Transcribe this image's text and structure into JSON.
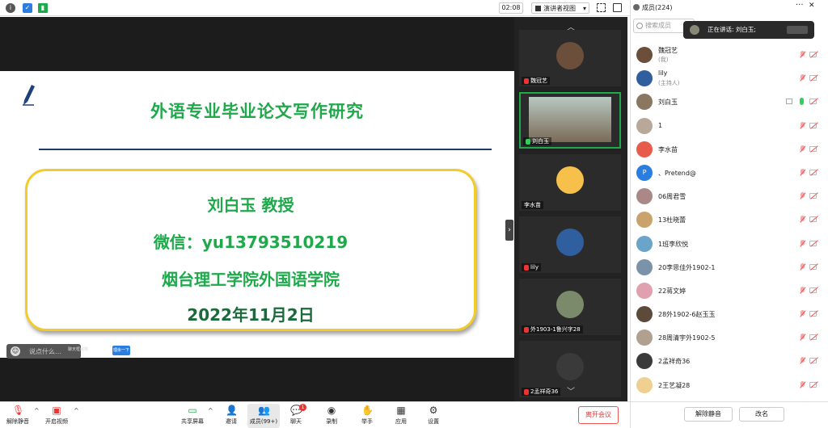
{
  "topbar": {
    "time": "02:08",
    "view_mode": "演讲者视图"
  },
  "slide": {
    "title": "外语专业毕业论文写作研究",
    "name_line": "刘白玉  教授",
    "wechat_line": "微信：yu13793510219",
    "org_line": "烟台理工学院外国语学院",
    "date_line": "2022年11月2日"
  },
  "chat": {
    "placeholder": "说点什么…",
    "tip": "聊天框缩略",
    "button": "理余一下"
  },
  "strip": {
    "tiles": [
      {
        "name": "魏冠艺",
        "color": "#6b4f3a",
        "mic": "muted"
      },
      {
        "name": "刘白玉",
        "color": "#8a7761",
        "mic": "on",
        "active": true
      },
      {
        "name": "李水苗",
        "color": "#f6c04a",
        "mic": "none"
      },
      {
        "name": "lily",
        "color": "#2f5f9e",
        "mic": "muted"
      },
      {
        "name": "外1903-1鲁兴字28",
        "color": "#7a8a6a",
        "mic": "muted"
      },
      {
        "name": "2孟祥奇36",
        "color": "#3a3a3a",
        "mic": "muted"
      }
    ]
  },
  "toolbar": {
    "unmute": "解除静音",
    "video": "开启视频",
    "share": "共享屏幕",
    "invite": "邀请",
    "members": "成员(99+)",
    "chat": "聊天",
    "chat_badge": "1",
    "record": "录制",
    "raise": "举手",
    "apps": "应用",
    "settings": "设置",
    "leave": "离开会议"
  },
  "panel": {
    "title": "成员(224)",
    "search_placeholder": "搜索成员",
    "speaking": "正在讲话: 刘白玉;",
    "members": [
      {
        "name": "魏冠艺",
        "role": "(我)",
        "color": "#6b4f3a"
      },
      {
        "name": "lily",
        "role": "(主持人)",
        "color": "#2f5f9e"
      },
      {
        "name": "刘白玉",
        "role": "",
        "color": "#8a7761",
        "speaking": true
      },
      {
        "name": "1",
        "role": "",
        "color": "#b7a89a"
      },
      {
        "name": "李水苗",
        "role": "",
        "color": "#e85a4a"
      },
      {
        "name": "、Pretend@",
        "role": "",
        "color": "#2a7de1",
        "initial": "P"
      },
      {
        "name": "06周君雪",
        "role": "",
        "color": "#a88"
      },
      {
        "name": "13杜晓蕾",
        "role": "",
        "color": "#c9a36b"
      },
      {
        "name": "1班李欣悦",
        "role": "",
        "color": "#6aa4c8"
      },
      {
        "name": "20李思佳外1902-1",
        "role": "",
        "color": "#7b93a8"
      },
      {
        "name": "22蒋文婷",
        "role": "",
        "color": "#e0a0b0"
      },
      {
        "name": "28外1902-6赵玉玉",
        "role": "",
        "color": "#5c4a3a"
      },
      {
        "name": "28周清宇外1902-5",
        "role": "",
        "color": "#b0a090"
      },
      {
        "name": "2孟祥奇36",
        "role": "",
        "color": "#3a3a3a"
      },
      {
        "name": "2王艺凝28",
        "role": "",
        "color": "#f0d090"
      }
    ],
    "unmute_all": "解除静音",
    "rename": "改名"
  }
}
